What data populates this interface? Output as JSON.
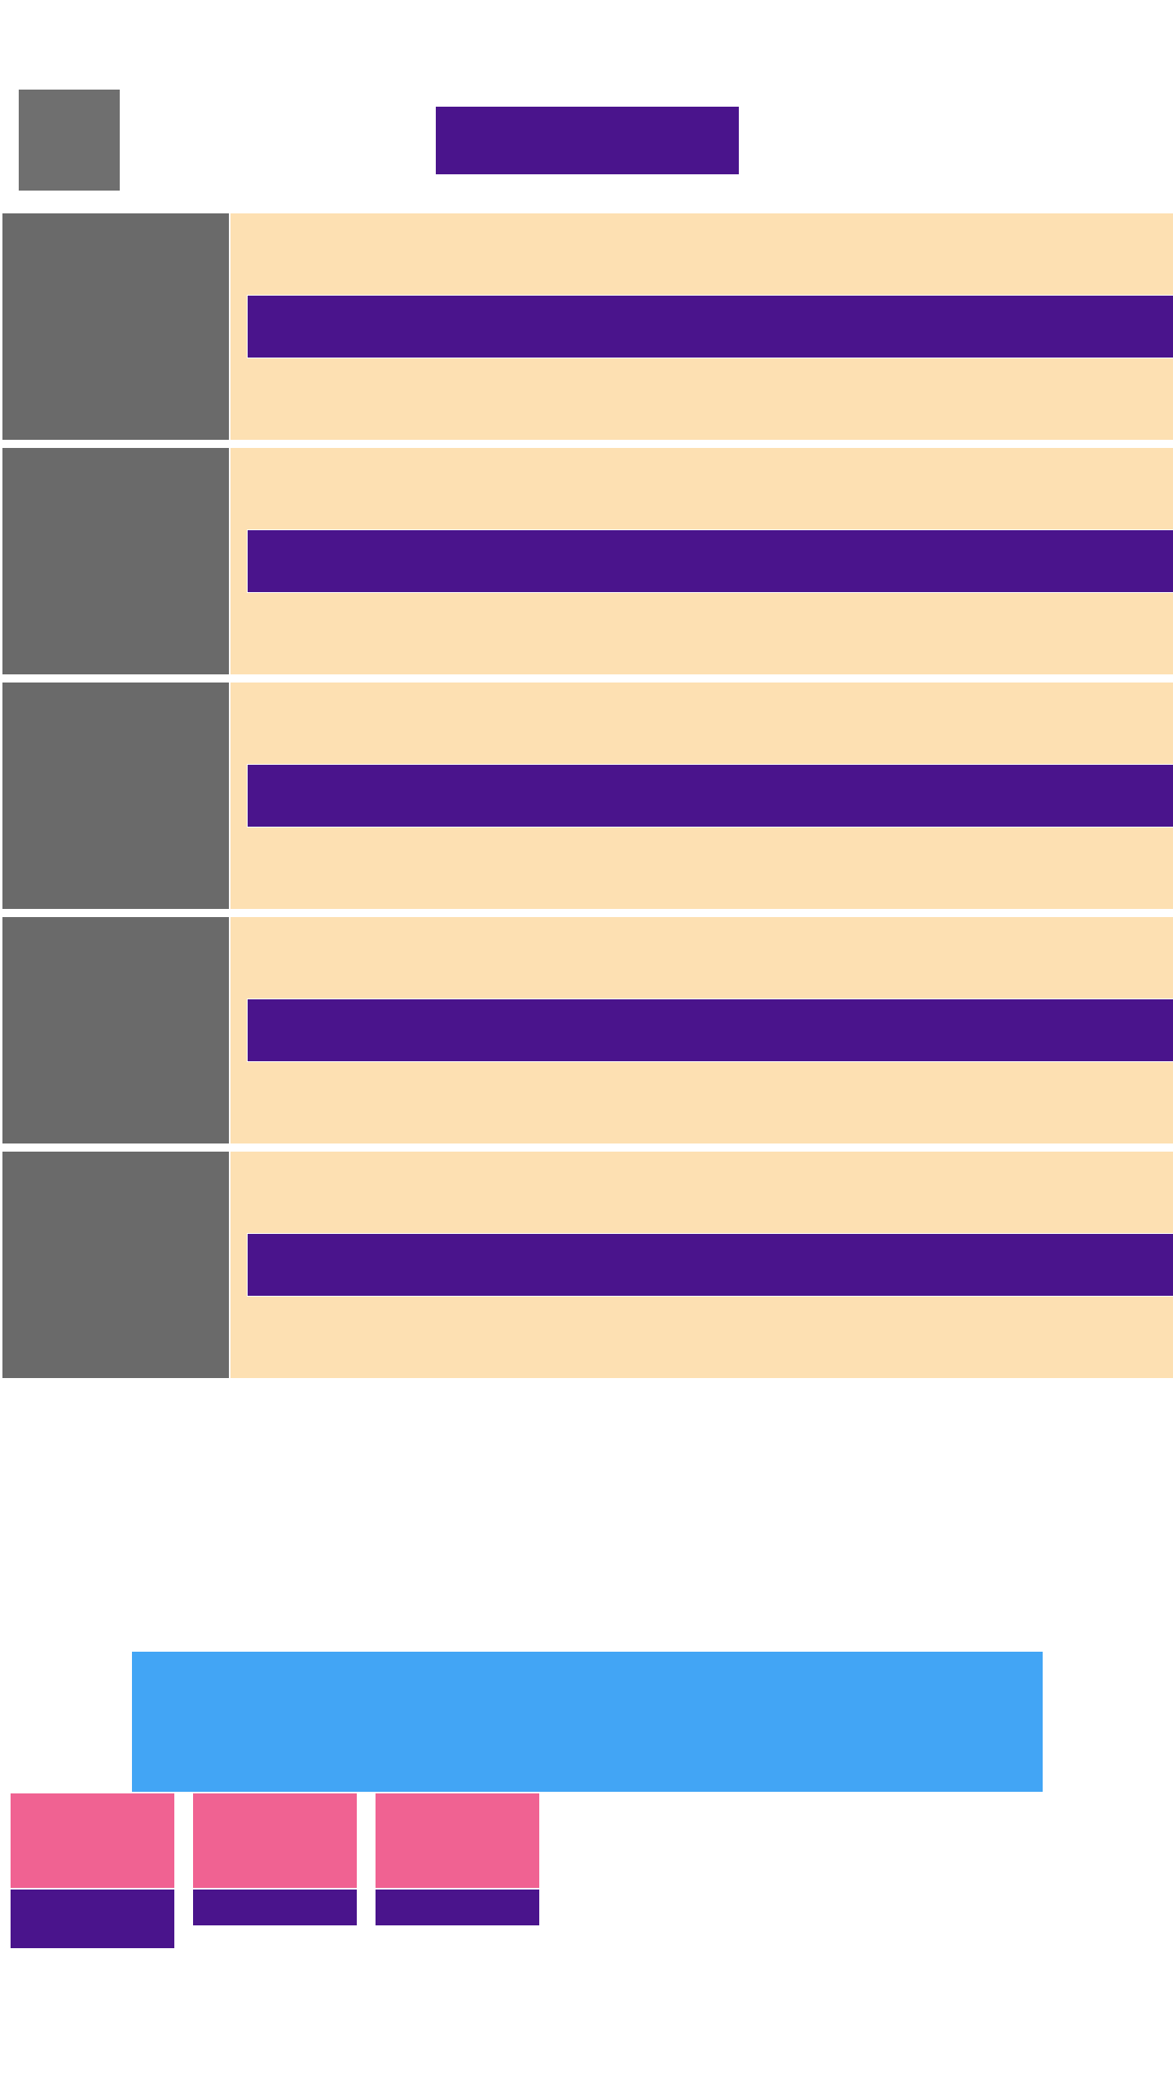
{
  "colors": {
    "background": "#ffffff",
    "placeholder_gray": "#6a6a6a",
    "avatar_gray": "#6f6f6f",
    "accent_purple": "#4a148c",
    "row_panel": "#fde0b2",
    "banner_blue": "#42a5f5",
    "card_pink": "#f06292"
  },
  "header": {
    "title": ""
  },
  "list": {
    "items": [
      {
        "label": ""
      },
      {
        "label": ""
      },
      {
        "label": ""
      },
      {
        "label": ""
      },
      {
        "label": ""
      }
    ]
  },
  "banner": {
    "text": ""
  },
  "cards": [
    {
      "caption": ""
    },
    {
      "caption": ""
    },
    {
      "caption": ""
    }
  ]
}
